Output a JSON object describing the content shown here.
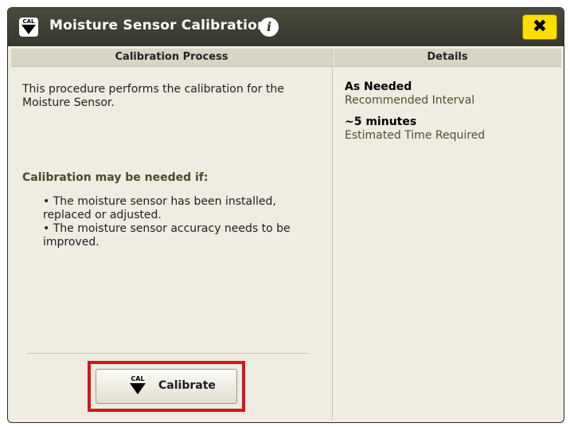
{
  "dialog": {
    "title": "Moisture Sensor Calibration",
    "title_icon": "cal-down-arrow-icon",
    "title_icon_text": "CAL",
    "info_icon": "i",
    "close_icon": "✖"
  },
  "left_panel": {
    "header": "Calibration Process",
    "intro": "This procedure performs the calibration for the Moisture Sensor.",
    "conditions_heading": "Calibration may be needed if:",
    "conditions": [
      "The moisture sensor has been installed, replaced or adjusted.",
      "The moisture sensor accuracy needs to be improved."
    ],
    "calibrate_button": {
      "icon_text": "CAL",
      "label": "Calibrate"
    }
  },
  "right_panel": {
    "header": "Details",
    "details": [
      {
        "value": "As Needed",
        "label": "Recommended Interval"
      },
      {
        "value": "~5 minutes",
        "label": "Estimated Time Required"
      }
    ]
  },
  "colors": {
    "title_bar": "#37362c",
    "close_button": "#ffde00",
    "highlight_border": "#d5151f",
    "panel_background": "#efece2"
  }
}
